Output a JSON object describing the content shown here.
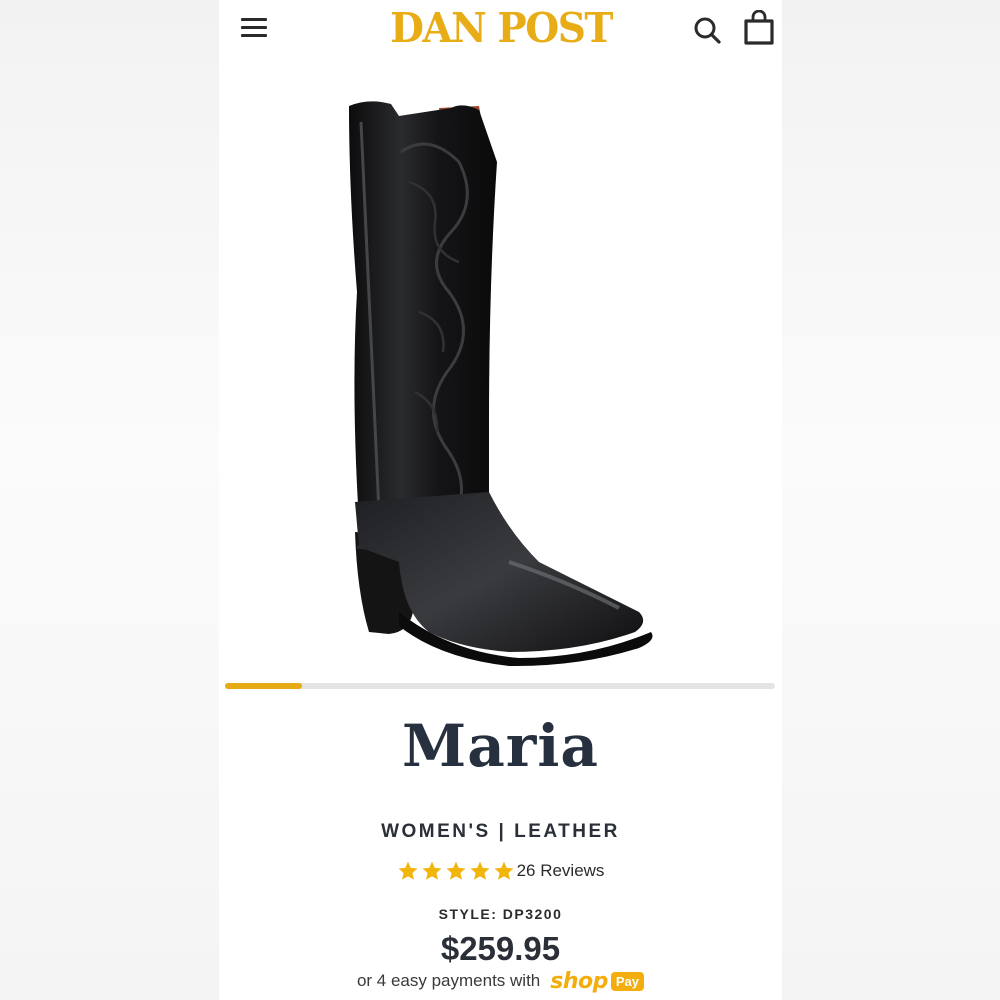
{
  "brand": {
    "logo_text": "DAN POST",
    "accent_color": "#e8ad16"
  },
  "header": {
    "menu_icon": "hamburger-icon",
    "search_icon": "search-icon",
    "cart_icon": "shopping-bag-icon"
  },
  "gallery": {
    "image_alt": "Black leather western boot",
    "progress_fraction": 0.14
  },
  "product": {
    "name": "Maria",
    "category": "WOMEN'S | LEATHER",
    "rating": 5,
    "reviews_label": "26 Reviews",
    "style_label": "STYLE: DP3200",
    "price": "$259.95",
    "installments_text": "or 4 easy payments with",
    "shop_pay": {
      "shop": "shop",
      "pay": "Pay"
    }
  }
}
